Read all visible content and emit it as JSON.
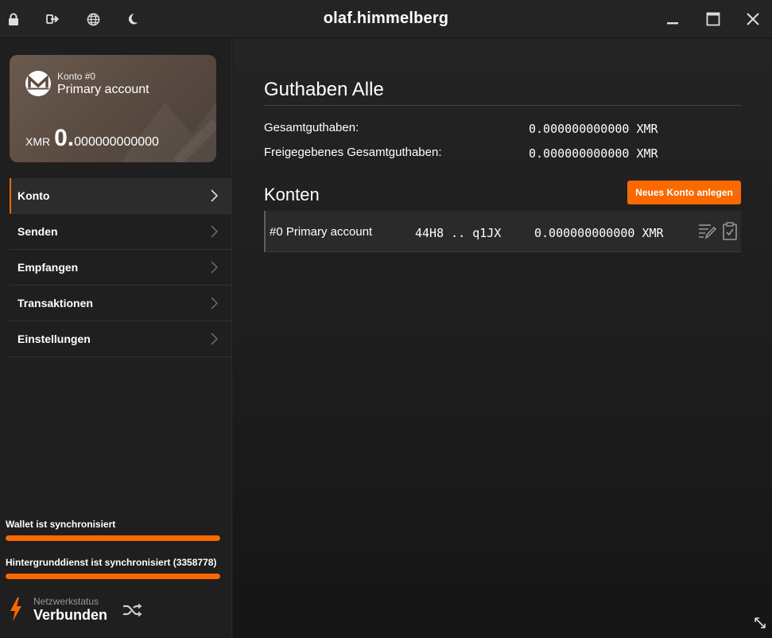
{
  "titlebar": {
    "title": "olaf.himmelberg",
    "icons": [
      "lock-icon",
      "logout-icon",
      "globe-icon",
      "moon-icon"
    ],
    "window_controls": [
      "minimize-icon",
      "maximize-icon",
      "close-icon"
    ]
  },
  "colors": {
    "accent": "#fa6800",
    "card": "#5c4d43",
    "background": "#1d1d1d"
  },
  "card": {
    "account_number": "Konto #0",
    "account_name": "Primary account",
    "currency": "XMR",
    "balance_int": "0.",
    "balance_frac": "000000000000"
  },
  "menu": [
    {
      "label": "Konto",
      "active": true
    },
    {
      "label": "Senden"
    },
    {
      "label": "Empfangen"
    },
    {
      "label": "Transaktionen"
    },
    {
      "label": "Einstellungen"
    }
  ],
  "sync": {
    "wallet_label": "Wallet ist synchronisiert",
    "wallet_progress": 1.0,
    "daemon_label": "Hintergrunddienst ist synchronisiert (3358778)",
    "daemon_progress": 1.0
  },
  "network": {
    "caption": "Netzwerkstatus",
    "status": "Verbunden"
  },
  "main": {
    "balance_title": "Guthaben Alle",
    "total_label": "Gesamtguthaben:",
    "total_value": "0.000000000000 XMR",
    "unlocked_label": "Freigegebenes Gesamtguthaben:",
    "unlocked_value": "0.000000000000 XMR",
    "accounts_title": "Konten",
    "new_account_button": "Neues Konto anlegen",
    "accounts": [
      {
        "name": "#0 Primary account",
        "address": "44H8 .. q1JX",
        "balance": "0.000000000000 XMR"
      }
    ]
  }
}
